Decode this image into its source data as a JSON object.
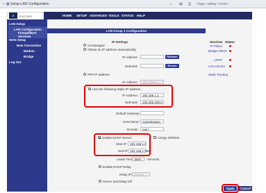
{
  "browser": {
    "tab_title": "Setup-LAN Configuration",
    "toolbar_text": "Page • Safety • Tools •"
  },
  "brand": {
    "logo_text": "ZHONE"
  },
  "topnav": [
    "HOME",
    "SETUP",
    "ADVANCED",
    "TOOLS",
    "STATUS",
    "HELP"
  ],
  "sidebar": {
    "items": [
      {
        "label": "LAN Setup"
      },
      {
        "label": "LAN Configuration"
      },
      {
        "label": "Firewall/NAT"
      },
      {
        "label": "Services"
      },
      {
        "label": "WAN Setup"
      },
      {
        "label": "New Connection"
      },
      {
        "label": "Modem"
      },
      {
        "label": "Bridge"
      },
      {
        "label": "Log Out"
      }
    ]
  },
  "content": {
    "title": "LAN Group 1 Configuration",
    "ip_settings_header": "IP Settings",
    "unmanaged_label": "Unmanaged",
    "dhcp_obtain_label": "Obtain an IP address automatically",
    "ip_address_label": "IP Address:",
    "netmask_label": "Netmask:",
    "release_label": "Release",
    "renew_label": "Renew",
    "ppp_label": "PPP IP address",
    "ppp_ip_label": "IP Address:",
    "ppp_ip_value": "192.168.0.1",
    "static_label": "Use the following Static IP address",
    "static_ip_label": "IP Address:",
    "static_ip_value": "192.168.1.1",
    "static_netmask_label": "Netmask:",
    "static_netmask_value": "255.255.255.0",
    "gateway_label": "Default Gateway:",
    "gateway_value": "",
    "hostname_label": "Host Name:",
    "hostname_value": "myGateway1",
    "domain_label": "Domain:",
    "domain_value": "meri",
    "enable_dhcp_label": "Enable DHCP Server",
    "assign_label": "Assign SIPDNS",
    "start_ip_label": "Start IP:",
    "start_ip_value": "192.168.1.2",
    "end_ip_label": "End IP:",
    "end_ip_value": "192.168.1.254",
    "lease_label": "Lease Time:",
    "lease_value": "3600",
    "lease_unit": "Seconds",
    "relay_label": "Enable DHCP Relay",
    "relay_ip_label": "Relay IP:",
    "relay_ip_value": "0.0.0.0",
    "server_relay_off_label": "Server and Relay Off"
  },
  "services": {
    "header_services": "Services",
    "header_status": "Status",
    "items": [
      "IP Filters",
      "Bridge Filters",
      "UPnP",
      "LAN Clients",
      "Static Routing"
    ]
  },
  "actions": {
    "apply": "Apply",
    "cancel": "Cancel"
  }
}
